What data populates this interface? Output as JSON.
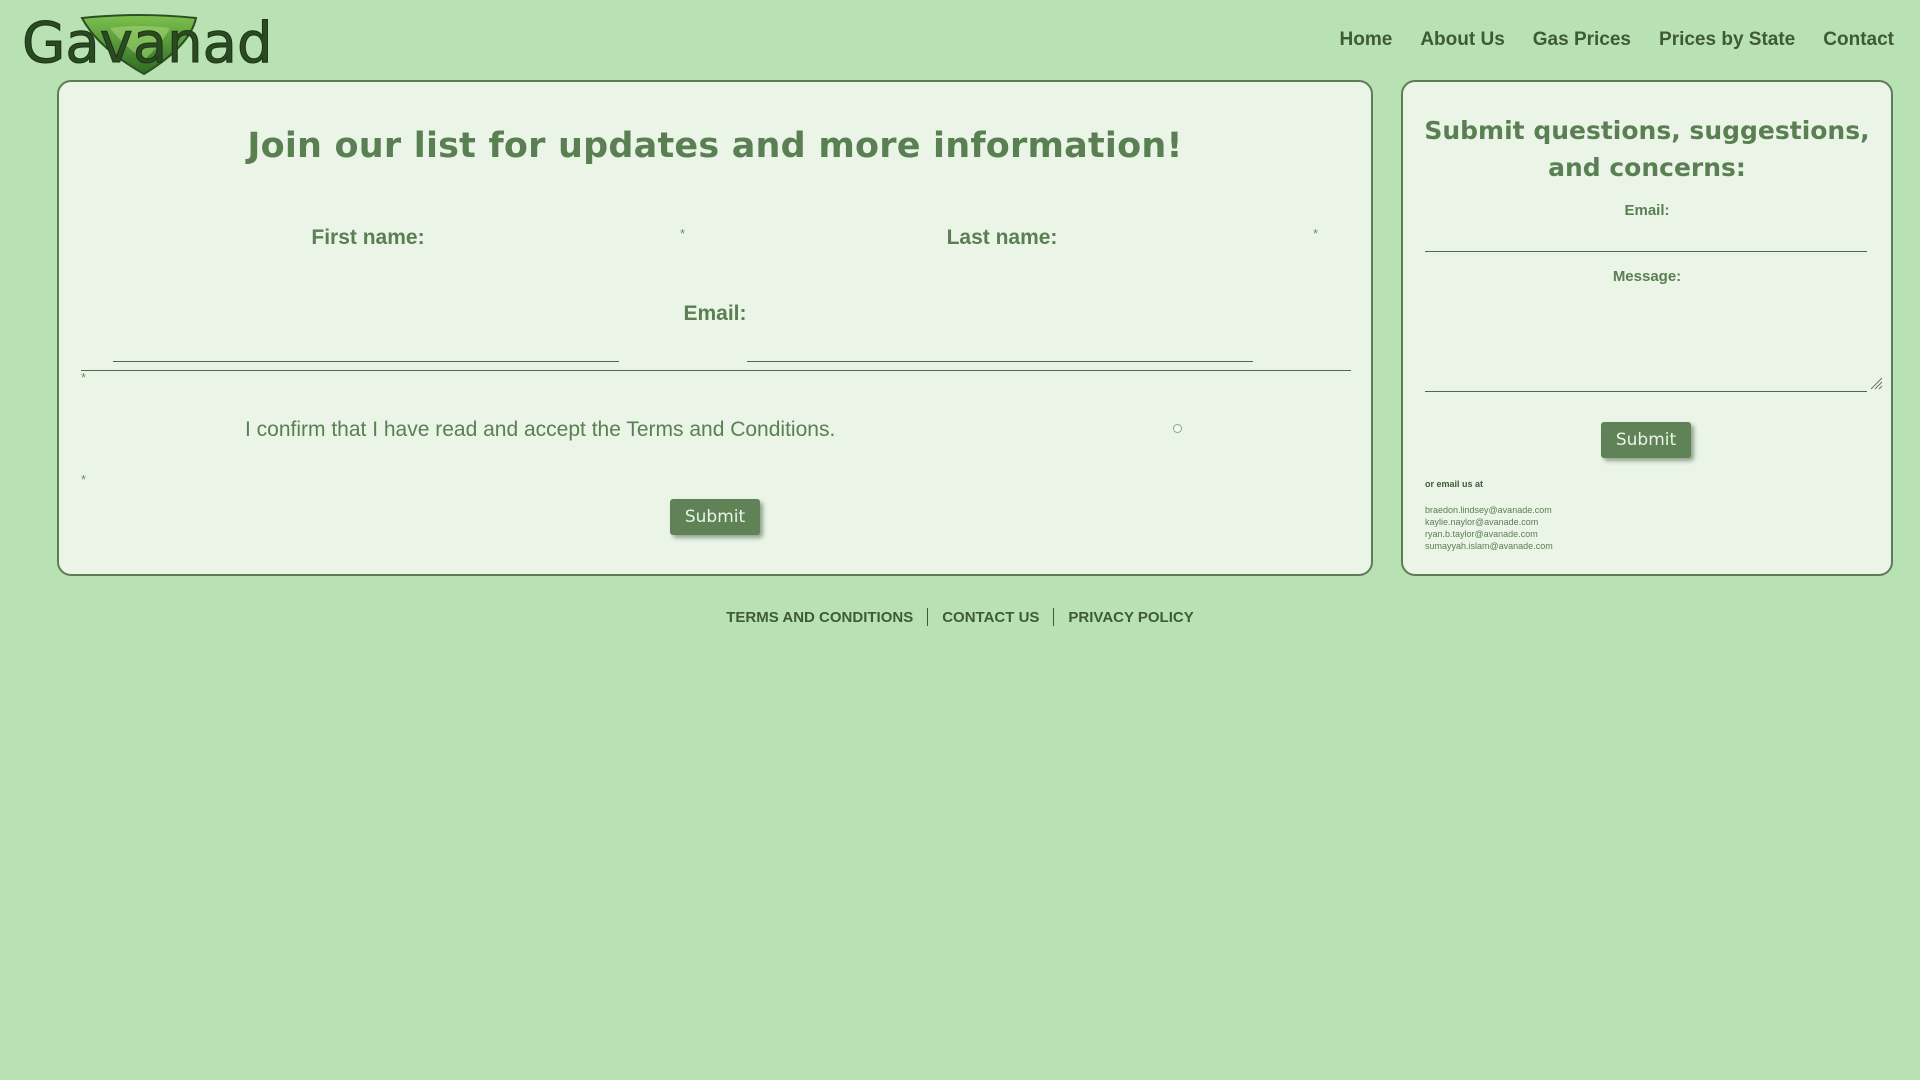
{
  "header": {
    "logo_text": "Gavanade",
    "nav": [
      {
        "label": "Home"
      },
      {
        "label": "About Us"
      },
      {
        "label": "Gas Prices"
      },
      {
        "label": "Prices by State"
      },
      {
        "label": "Contact"
      }
    ]
  },
  "signup": {
    "title": "Join our list for updates and more information!",
    "first_name_label": "First name:",
    "last_name_label": "Last name:",
    "email_label": "Email:",
    "required_marker": "*",
    "confirm_text": "I confirm that I have read and accept the Terms and Conditions.",
    "submit_label": "Submit"
  },
  "contact": {
    "title": "Submit questions, suggestions, and concerns:",
    "email_label": "Email:",
    "message_label": "Message:",
    "submit_label": "Submit",
    "or_email_text": "or email us at",
    "emails": [
      "braedon.lindsey@avanade.com",
      "kaylie.naylor@avanade.com",
      "ryan.b.taylor@avanade.com",
      "sumayyah.islam@avanade.com"
    ]
  },
  "footer": {
    "links": [
      {
        "label": "TERMS AND CONDITIONS"
      },
      {
        "label": "CONTACT US"
      },
      {
        "label": "PRIVACY POLICY"
      }
    ]
  },
  "colors": {
    "background": "#b8e2b3",
    "panel": "#eaf5e8",
    "text_green": "#5a7f52",
    "dark_green": "#3f5a38",
    "button": "#5f8256"
  }
}
